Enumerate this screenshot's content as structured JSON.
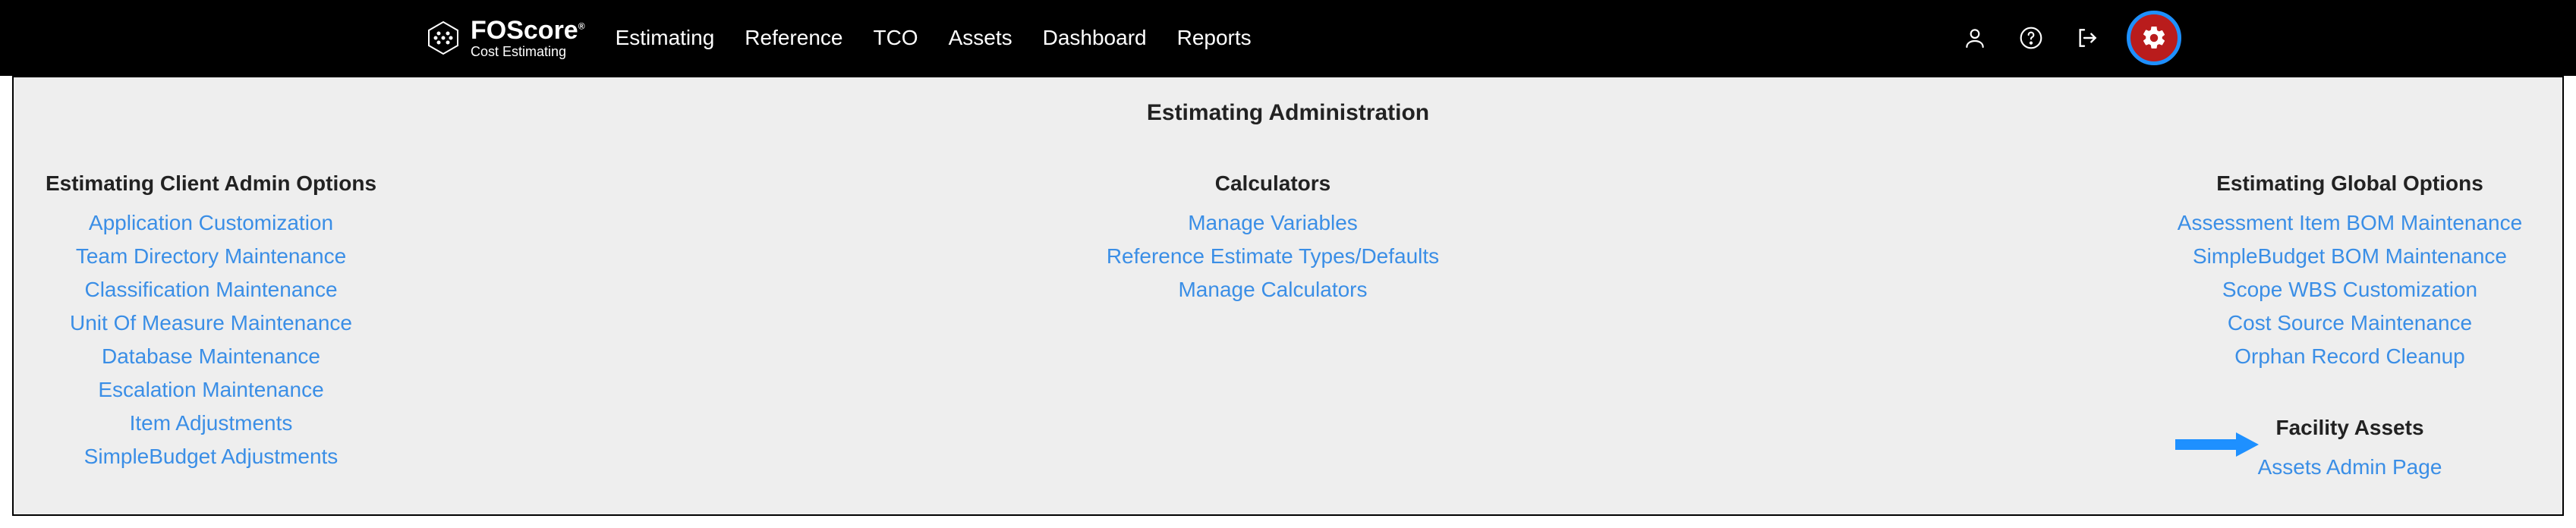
{
  "brand": {
    "name": "FOScore",
    "tagline": "Cost Estimating",
    "reg": "®"
  },
  "nav": {
    "items": [
      "Estimating",
      "Reference",
      "TCO",
      "Assets",
      "Dashboard",
      "Reports"
    ]
  },
  "admin": {
    "title": "Estimating Administration",
    "left": {
      "heading": "Estimating Client Admin Options",
      "links": [
        "Application Customization",
        "Team Directory Maintenance",
        "Classification Maintenance",
        "Unit Of Measure Maintenance",
        "Database Maintenance",
        "Escalation Maintenance",
        "Item Adjustments",
        "SimpleBudget Adjustments"
      ]
    },
    "center": {
      "heading": "Calculators",
      "links": [
        "Manage Variables",
        "Reference Estimate Types/Defaults",
        "Manage Calculators"
      ]
    },
    "right": {
      "heading": "Estimating Global Options",
      "links": [
        "Assessment Item BOM Maintenance",
        "SimpleBudget BOM Maintenance",
        "Scope WBS Customization",
        "Cost Source Maintenance",
        "Orphan Record Cleanup"
      ],
      "heading2": "Facility Assets",
      "links2": [
        "Assets Admin Page"
      ]
    }
  },
  "colors": {
    "link": "#3a8ee6",
    "highlight_bg": "#b91c1c",
    "highlight_ring": "#1e90ff",
    "arrow": "#1e90ff"
  }
}
